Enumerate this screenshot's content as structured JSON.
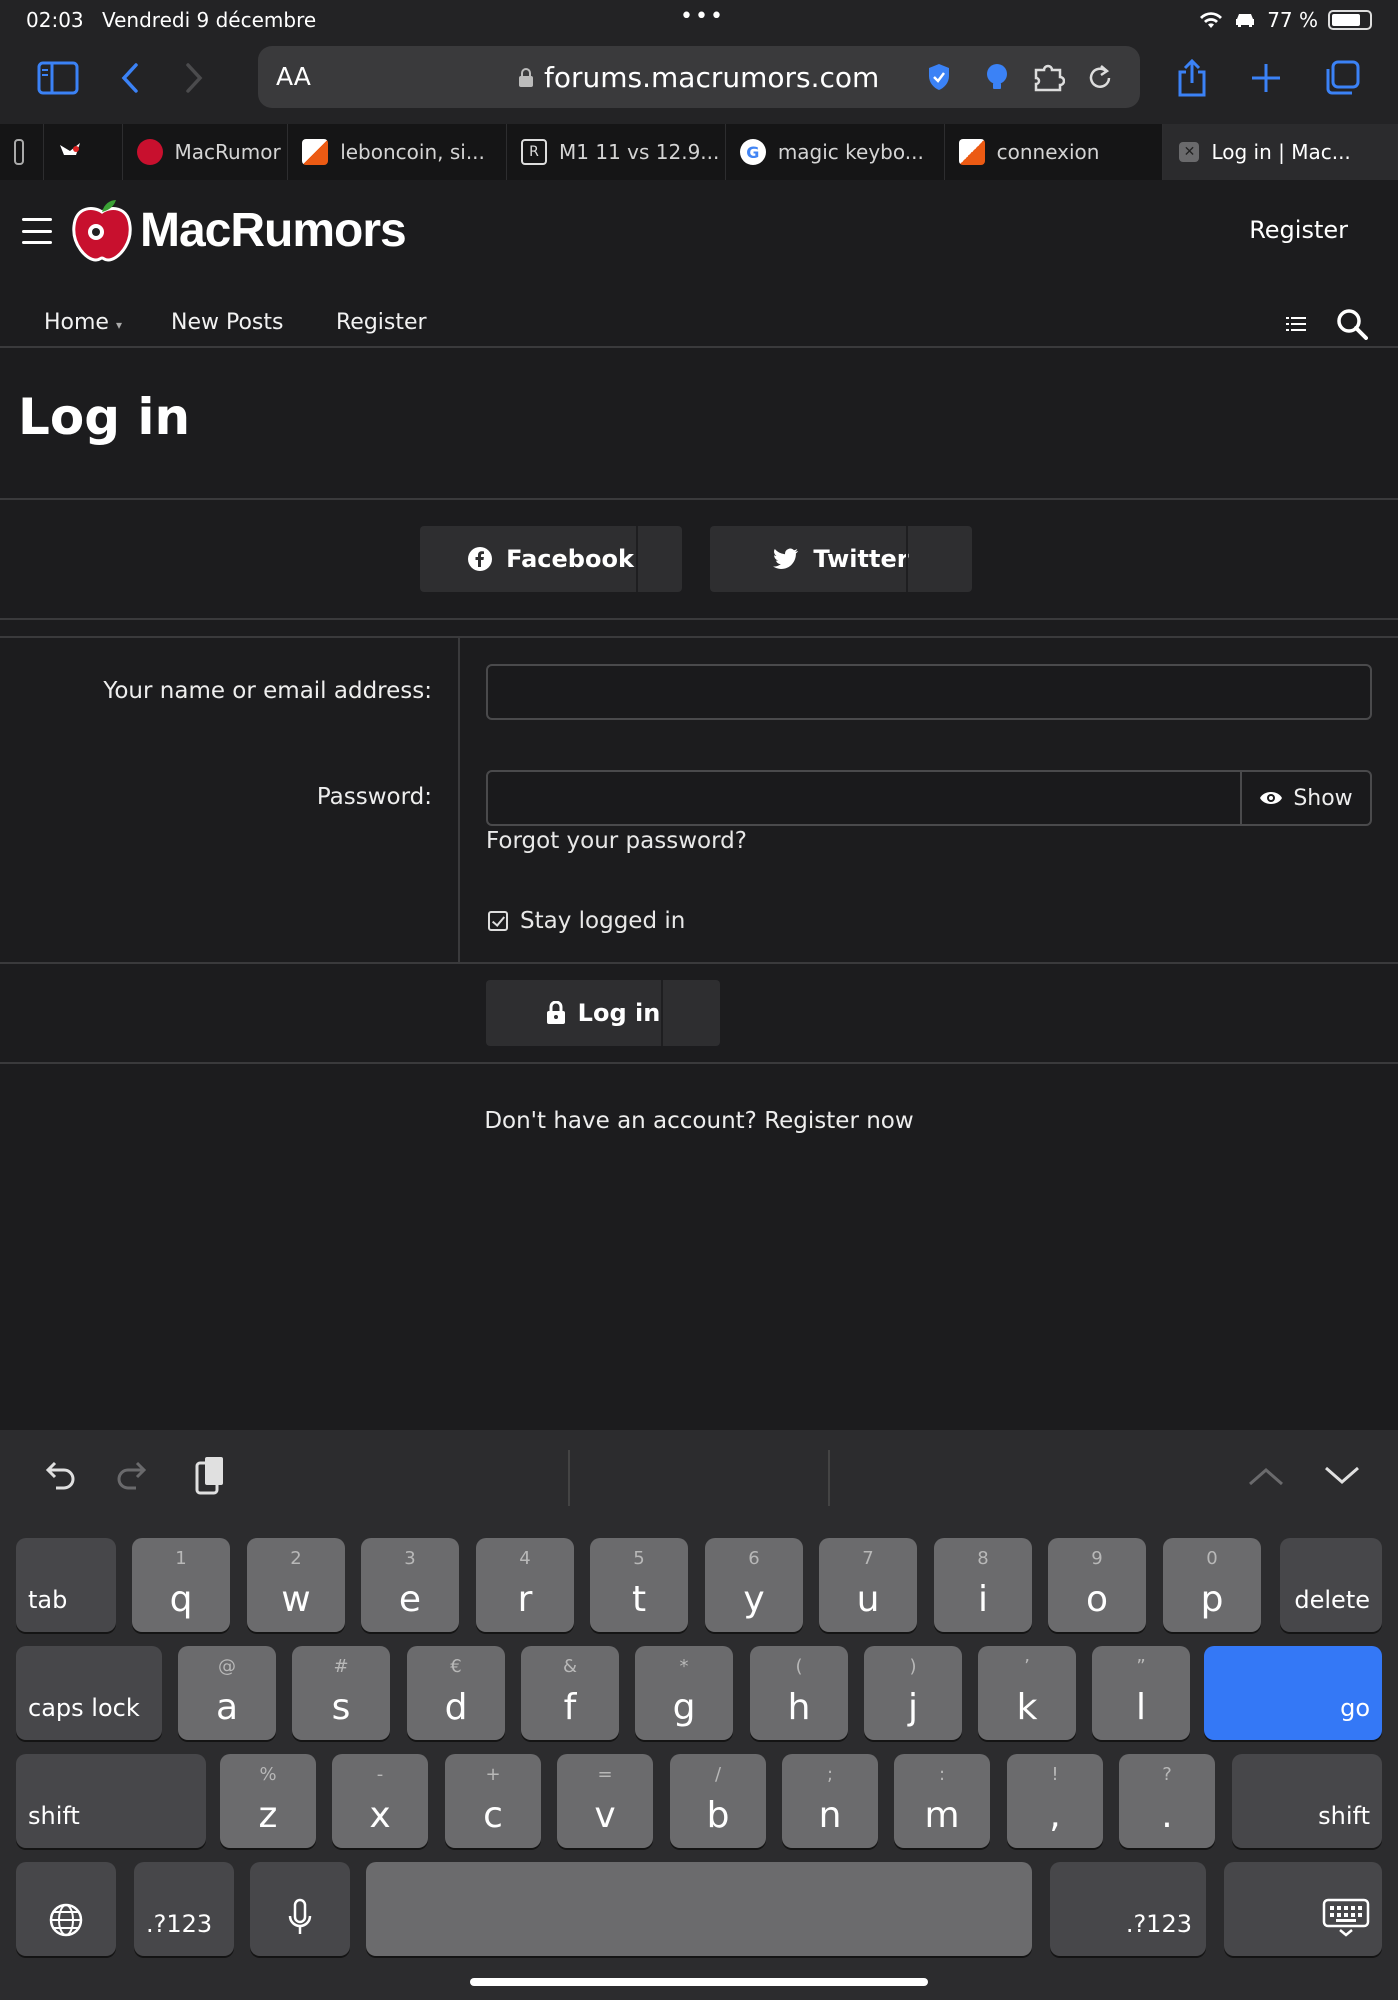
{
  "status_bar": {
    "time": "02:03",
    "date": "Vendredi 9 décembre",
    "battery": "77 %",
    "battery_level": 0.77
  },
  "browser": {
    "aa_label": "AA",
    "url": "forums.macrumors.com",
    "tabs": [
      {
        "label": "",
        "icon": "blank-icon"
      },
      {
        "label": "",
        "icon": "bird-icon"
      },
      {
        "label": "MacRumor",
        "icon": "macrumors-icon"
      },
      {
        "label": "leboncoin, si...",
        "icon": "leboncoin-icon"
      },
      {
        "label": "M1 11 vs 12.9...",
        "icon": "r-icon"
      },
      {
        "label": "magic keybo...",
        "icon": "google-icon"
      },
      {
        "label": "connexion",
        "icon": "leboncoin-icon"
      },
      {
        "label": "Log in | Mac...",
        "icon": "close-icon"
      }
    ]
  },
  "site": {
    "logo_text": "MacRumors",
    "header_register": "Register",
    "nav": {
      "home": "Home",
      "new_posts": "New Posts",
      "register": "Register"
    }
  },
  "login": {
    "title": "Log in",
    "facebook_label": "Facebook",
    "twitter_label": "Twitter",
    "name_label": "Your name or email address:",
    "name_value": "",
    "password_label": "Password:",
    "password_value": "",
    "show_label": "Show",
    "forgot_label": "Forgot your password?",
    "stay_logged_label": "Stay logged in",
    "login_button": "Log in",
    "register_prompt": "Don't have an account? Register now"
  },
  "keyboard": {
    "row1": [
      {
        "main": "q",
        "sub": "1"
      },
      {
        "main": "w",
        "sub": "2"
      },
      {
        "main": "e",
        "sub": "3"
      },
      {
        "main": "r",
        "sub": "4"
      },
      {
        "main": "t",
        "sub": "5"
      },
      {
        "main": "y",
        "sub": "6"
      },
      {
        "main": "u",
        "sub": "7"
      },
      {
        "main": "i",
        "sub": "8"
      },
      {
        "main": "o",
        "sub": "9"
      },
      {
        "main": "p",
        "sub": "0"
      }
    ],
    "row2": [
      {
        "main": "a",
        "sub": "@"
      },
      {
        "main": "s",
        "sub": "#"
      },
      {
        "main": "d",
        "sub": "€"
      },
      {
        "main": "f",
        "sub": "&"
      },
      {
        "main": "g",
        "sub": "*"
      },
      {
        "main": "h",
        "sub": "("
      },
      {
        "main": "j",
        "sub": ")"
      },
      {
        "main": "k",
        "sub": "’"
      },
      {
        "main": "l",
        "sub": "”"
      }
    ],
    "row3": [
      {
        "main": "z",
        "sub": "%"
      },
      {
        "main": "x",
        "sub": "-"
      },
      {
        "main": "c",
        "sub": "+"
      },
      {
        "main": "v",
        "sub": "="
      },
      {
        "main": "b",
        "sub": "/"
      },
      {
        "main": "n",
        "sub": ";"
      },
      {
        "main": "m",
        "sub": ":"
      },
      {
        "main": ",",
        "sub": "!"
      },
      {
        "main": ".",
        "sub": "?"
      }
    ],
    "tab": "tab",
    "delete": "delete",
    "caps_lock": "caps lock",
    "go": "go",
    "shift": "shift",
    "num": ".?123"
  }
}
